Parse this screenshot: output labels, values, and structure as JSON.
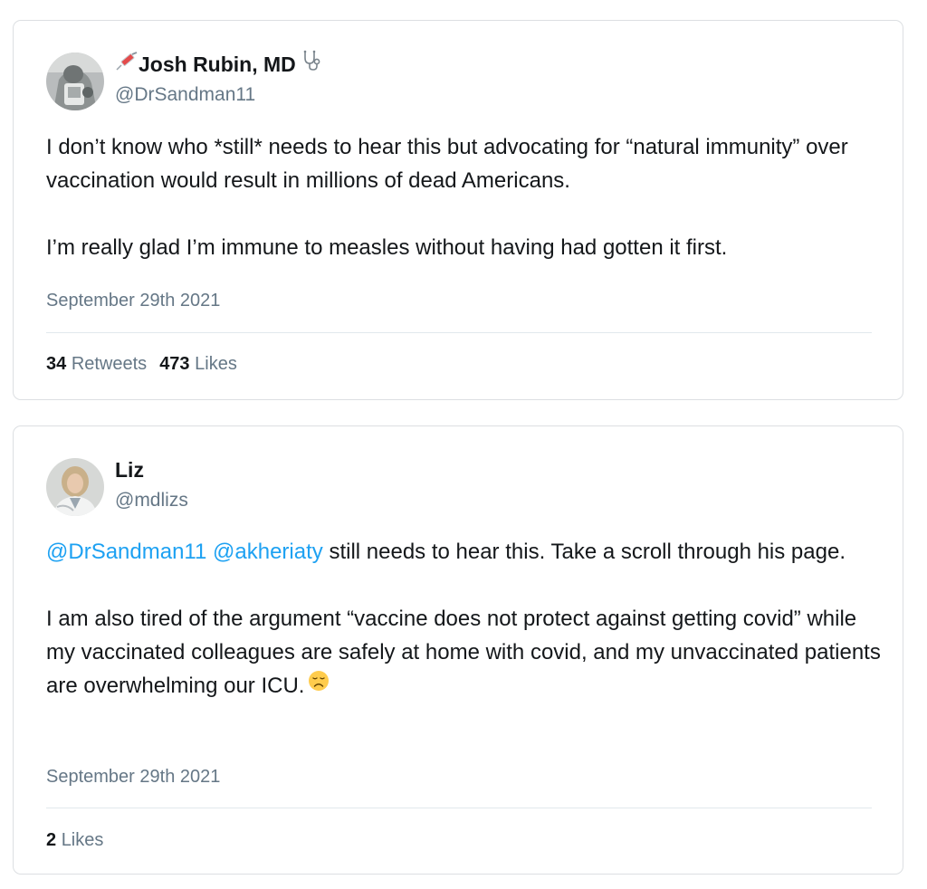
{
  "tweets": [
    {
      "user": {
        "display_name": "Josh Rubin, MD",
        "handle": "@DrSandman11",
        "name_prefix_icon": "syringe-icon",
        "name_suffix_icon": "stethoscope-icon"
      },
      "paragraphs": [
        "I don’t know who *still* needs to hear this but advocating for “natural immunity” over vaccination would result in millions of dead Americans.",
        "I’m really glad I’m immune to measles without having had gotten it first."
      ],
      "date": "September 29th 2021",
      "stats": {
        "retweets_count": "34",
        "retweets_label": "Retweets",
        "likes_count": "473",
        "likes_label": "Likes"
      }
    },
    {
      "user": {
        "display_name": "Liz",
        "handle": "@mdlizs"
      },
      "mentions": [
        "@DrSandman11",
        "@akheriaty"
      ],
      "paragraphs": [
        "still needs to hear this. Take a scroll through his page.",
        "I am also tired of the argument “vaccine does not protect against getting covid” while my vaccinated colleagues are safely at home with covid, and my unvaccinated patients are overwhelming our ICU."
      ],
      "trailing_icon": "disappointed-face-icon",
      "date": "September 29th 2021",
      "stats": {
        "likes_count": "2",
        "likes_label": "Likes"
      }
    }
  ],
  "colors": {
    "text": "#14171a",
    "secondary": "#657786",
    "link": "#1da1f2",
    "border": "#dcdfe2",
    "divider": "#e1e8ed"
  }
}
